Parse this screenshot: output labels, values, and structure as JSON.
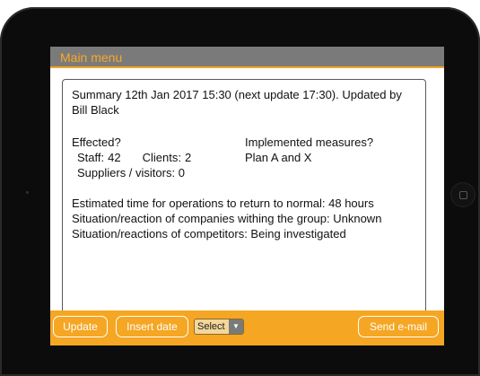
{
  "menu": {
    "title": "Main menu"
  },
  "summary": {
    "text": "Summary 12th Jan 2017 15:30 (next update 17:30). Updated by Bill Black"
  },
  "affected": {
    "heading": "Effected?",
    "staff_label": "Staff:",
    "staff_value": "42",
    "clients_label": "Clients:",
    "clients_value": "2",
    "suppliers_label": "Suppliers / visitors:",
    "suppliers_value": "0"
  },
  "measures": {
    "heading": "Implemented measures?",
    "value": "Plan A and X"
  },
  "status": {
    "line1": "Estimated time for operations to return to normal: 48 hours",
    "line2": "Situation/reaction of companies withing the group: Unknown",
    "line3": "Situation/reactions of competitors: Being investigated"
  },
  "toolbar": {
    "update_label": "Update",
    "insert_date_label": "Insert date",
    "select_value": "Select",
    "send_email_label": "Send e-mail"
  },
  "colors": {
    "accent": "#f5a623",
    "menu_bar": "#7a7a7a"
  },
  "icons": {
    "dropdown": "chevron-down-icon",
    "home": "home-button-icon"
  }
}
